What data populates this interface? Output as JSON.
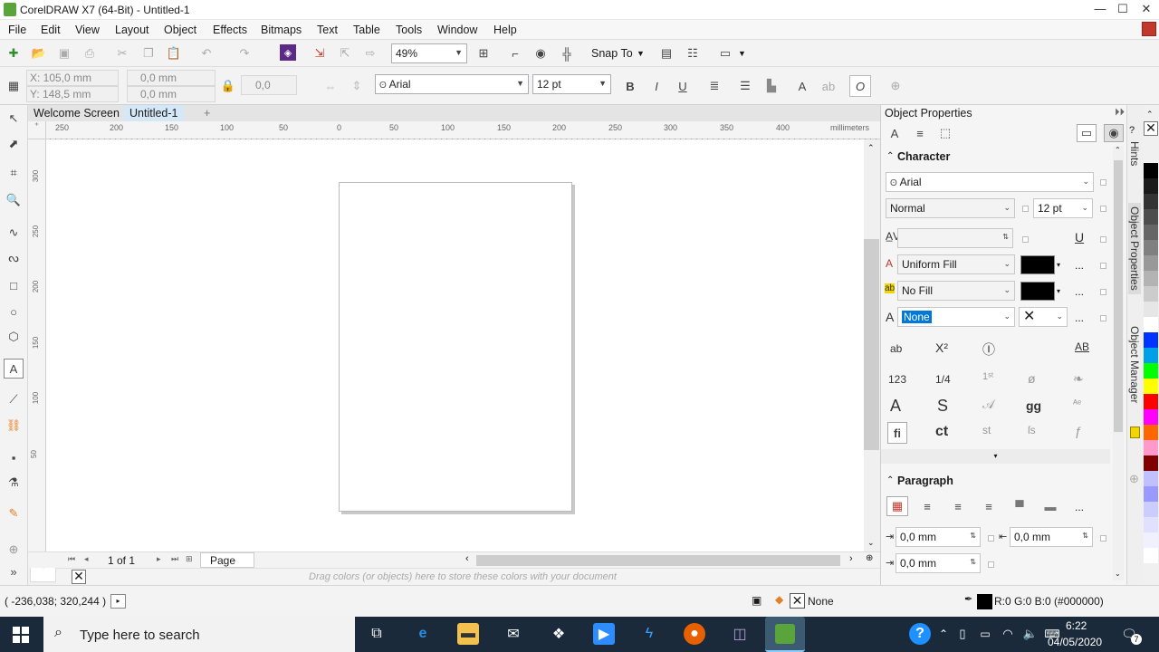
{
  "window": {
    "title": "CorelDRAW X7 (64-Bit) - Untitled-1",
    "controls": {
      "minimize": "—",
      "maximize": "☐",
      "close": "✕"
    }
  },
  "menu": [
    "File",
    "Edit",
    "View",
    "Layout",
    "Object",
    "Effects",
    "Bitmaps",
    "Text",
    "Table",
    "Tools",
    "Window",
    "Help"
  ],
  "toolbar": {
    "zoom": "49%",
    "snap_to": "Snap To"
  },
  "propbar": {
    "x": "X: 105,0 mm",
    "y": "Y: 148,5 mm",
    "w": "0,0 mm",
    "h": "0,0 mm",
    "angle": "0,0",
    "font": "Arial",
    "font_size": "12 pt"
  },
  "tabs": {
    "welcome": "Welcome Screen",
    "doc": "Untitled-1",
    "add": "+"
  },
  "ruler": {
    "units": "millimeters",
    "h_ticks": [
      "250",
      "200",
      "150",
      "100",
      "50",
      "0",
      "50",
      "100",
      "150",
      "200",
      "250",
      "300",
      "350",
      "400"
    ],
    "v_ticks": [
      "300",
      "250",
      "200",
      "150",
      "100",
      "50"
    ]
  },
  "pages": {
    "count": "1 of 1",
    "page_tab": "Page 1"
  },
  "palette_hint": "Drag colors (or objects) here to store these colors with your document",
  "status": {
    "coords": "( -236,038; 320,244 )",
    "fill_label": "None",
    "outline_label": "R:0 G:0 B:0 (#000000)"
  },
  "docker": {
    "title": "Object Properties",
    "character": {
      "heading": "Character",
      "font": "Arial",
      "style": "Normal",
      "size": "12 pt",
      "fill_type": "Uniform Fill",
      "bg_fill": "No Fill",
      "outline": "None",
      "more": "..."
    },
    "paragraph": {
      "heading": "Paragraph",
      "indent1": "0,0 mm",
      "indent2": "0,0 mm",
      "indent3": "0,0 mm"
    }
  },
  "vtabs": {
    "hints": "Hints",
    "props": "Object Properties",
    "manager": "Object Manager"
  },
  "palette_colors": [
    "#000000",
    "#1a1a1a",
    "#333333",
    "#4d4d4d",
    "#666666",
    "#808080",
    "#999999",
    "#b3b3b3",
    "#cccccc",
    "#e6e6e6",
    "#ffffff",
    "#0033ff",
    "#00a0e9",
    "#00ff00",
    "#ffff00",
    "#ff0000",
    "#ff00ff",
    "#ff6600",
    "#ff99cc",
    "#800000",
    "#c0c0ff",
    "#9999ff",
    "#ccccff",
    "#e0e0ff",
    "#f0f0ff",
    "#ffffff"
  ],
  "taskbar": {
    "search_placeholder": "Type here to search",
    "time": "6:22",
    "date": "04/05/2020",
    "notif": "7"
  }
}
